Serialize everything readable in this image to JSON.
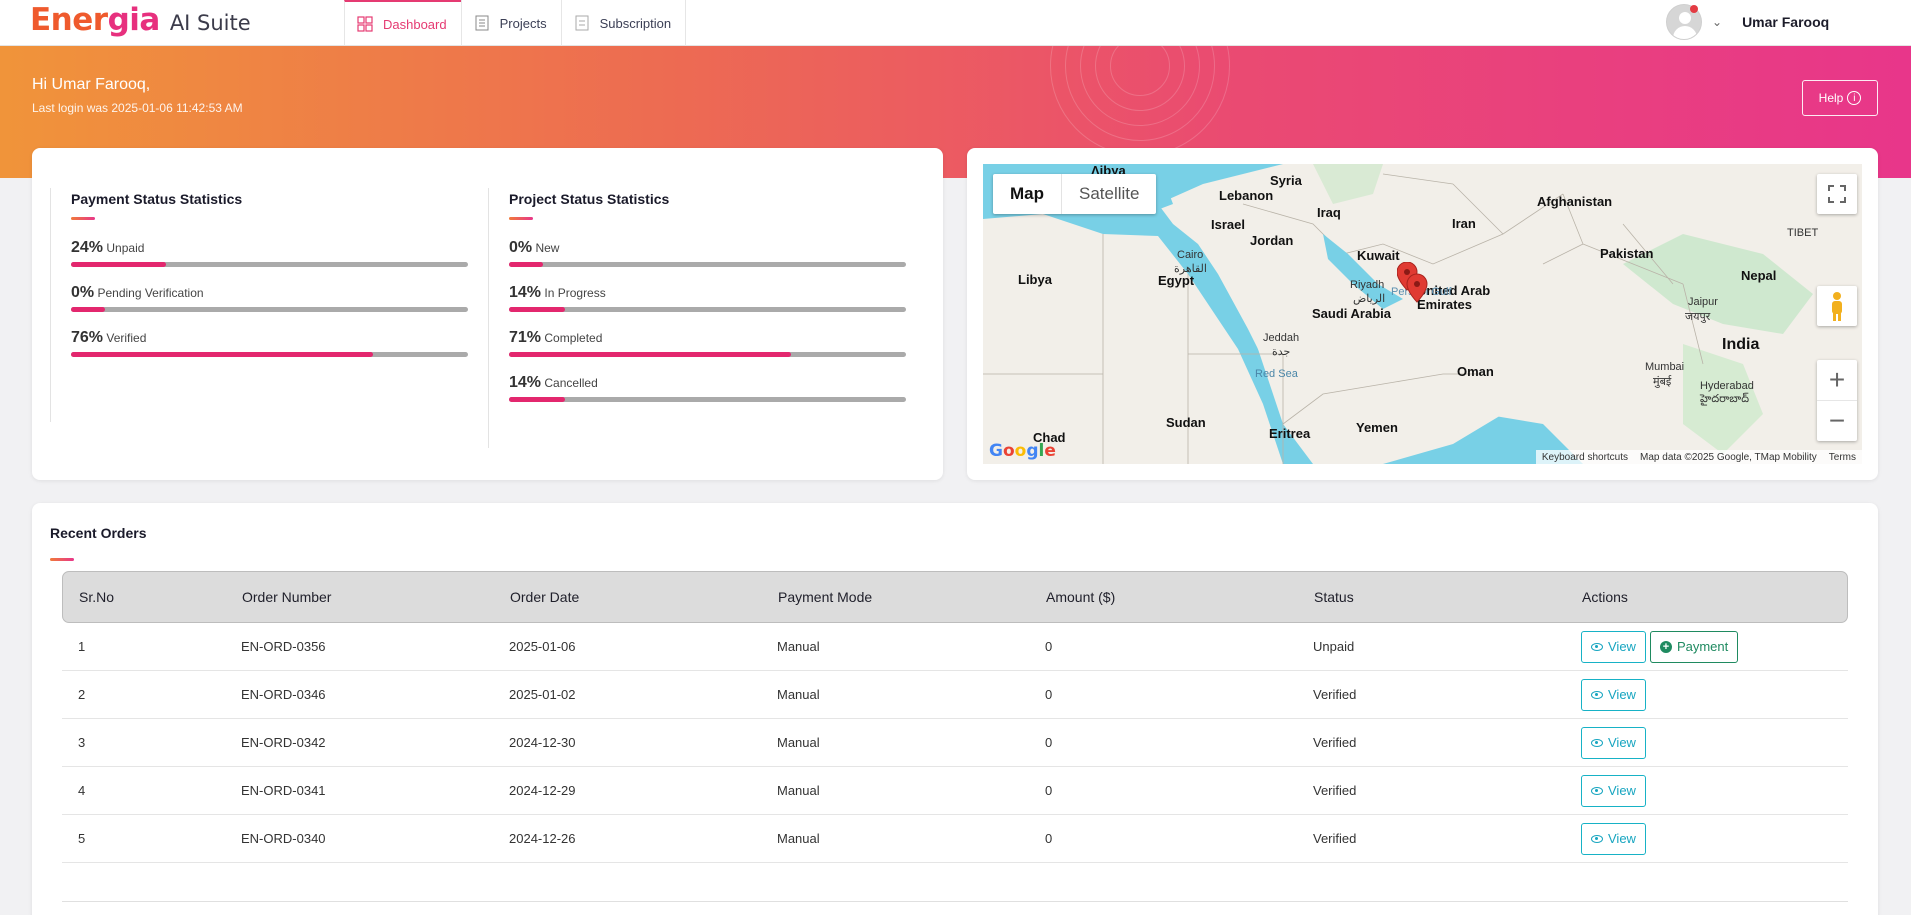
{
  "brand": {
    "name_part1": "Ener",
    "name_part2": "gia",
    "suite": "AI Suite"
  },
  "nav": [
    {
      "label": "Dashboard",
      "icon": "dashboard-icon",
      "active": true
    },
    {
      "label": "Projects",
      "icon": "projects-icon",
      "active": false
    },
    {
      "label": "Subscription",
      "icon": "subscription-icon",
      "active": false
    }
  ],
  "user": {
    "name": "Umar Farooq"
  },
  "banner": {
    "greeting": "Hi Umar Farooq,",
    "last_login": "Last login was 2025-01-06 11:42:53 AM",
    "help_label": "Help"
  },
  "payment_stats": {
    "title": "Payment Status Statistics",
    "rows": [
      {
        "pct": "24%",
        "label": "Unpaid",
        "value": 24
      },
      {
        "pct": "0%",
        "label": "Pending Verification",
        "value": 0
      },
      {
        "pct": "76%",
        "label": "Verified",
        "value": 76
      }
    ]
  },
  "project_stats": {
    "title": "Project Status Statistics",
    "rows": [
      {
        "pct": "0%",
        "label": "New",
        "value": 0
      },
      {
        "pct": "14%",
        "label": "In Progress",
        "value": 14
      },
      {
        "pct": "71%",
        "label": "Completed",
        "value": 71
      },
      {
        "pct": "14%",
        "label": "Cancelled",
        "value": 14
      }
    ]
  },
  "map": {
    "map_label": "Map",
    "satellite_label": "Satellite",
    "labels": {
      "syria": "Syria",
      "lebanon": "Lebanon",
      "israel": "Israel",
      "jordan": "Jordan",
      "iraq": "Iraq",
      "iran": "Iran",
      "afghanistan": "Afghanistan",
      "pakistan": "Pakistan",
      "kuwait": "Kuwait",
      "libya": "Libya",
      "egypt": "Egypt",
      "cairo": "Cairo",
      "cairo_ar": "القاهرة",
      "riyadh": "Riyadh",
      "riyadh_ar": "الرياض",
      "saudi": "Saudi Arabia",
      "uae": "United Arab Emirates",
      "nepal": "Nepal",
      "jaipur": "Jaipur",
      "jaipur_hi": "जयपुर",
      "india": "India",
      "jeddah": "Jeddah",
      "jeddah_ar": "جدة",
      "red_sea": "Red Sea",
      "oman": "Oman",
      "mumbai": "Mumbai",
      "mumbai_mr": "मुंबई",
      "hyderabad": "Hyderabad",
      "hyderabad_te": "హైదరాబాద్",
      "sudan": "Sudan",
      "chad": "Chad",
      "eritrea": "Eritrea",
      "yemen": "Yemen",
      "tibet": "TIBET",
      "persian_gulf": "Persian Gulf"
    },
    "attribution": {
      "shortcuts": "Keyboard shortcuts",
      "data": "Map data ©2025 Google, TMap Mobility",
      "terms": "Terms"
    },
    "google": "Google"
  },
  "orders": {
    "title": "Recent Orders",
    "columns": [
      "Sr.No",
      "Order Number",
      "Order Date",
      "Payment Mode",
      "Amount ($)",
      "Status",
      "Actions"
    ],
    "view_label": "View",
    "payment_label": "Payment",
    "rows": [
      {
        "sr": "1",
        "number": "EN-ORD-0356",
        "date": "2025-01-06",
        "mode": "Manual",
        "amount": "0",
        "status": "Unpaid",
        "payable": true
      },
      {
        "sr": "2",
        "number": "EN-ORD-0346",
        "date": "2025-01-02",
        "mode": "Manual",
        "amount": "0",
        "status": "Verified",
        "payable": false
      },
      {
        "sr": "3",
        "number": "EN-ORD-0342",
        "date": "2024-12-30",
        "mode": "Manual",
        "amount": "0",
        "status": "Verified",
        "payable": false
      },
      {
        "sr": "4",
        "number": "EN-ORD-0341",
        "date": "2024-12-29",
        "mode": "Manual",
        "amount": "0",
        "status": "Verified",
        "payable": false
      },
      {
        "sr": "5",
        "number": "EN-ORD-0340",
        "date": "2024-12-26",
        "mode": "Manual",
        "amount": "0",
        "status": "Verified",
        "payable": false
      }
    ]
  },
  "colors": {
    "accent": "#e53a72",
    "bar_fill": "#e3276e",
    "view": "#17a5c0",
    "pay": "#1f8a60"
  }
}
